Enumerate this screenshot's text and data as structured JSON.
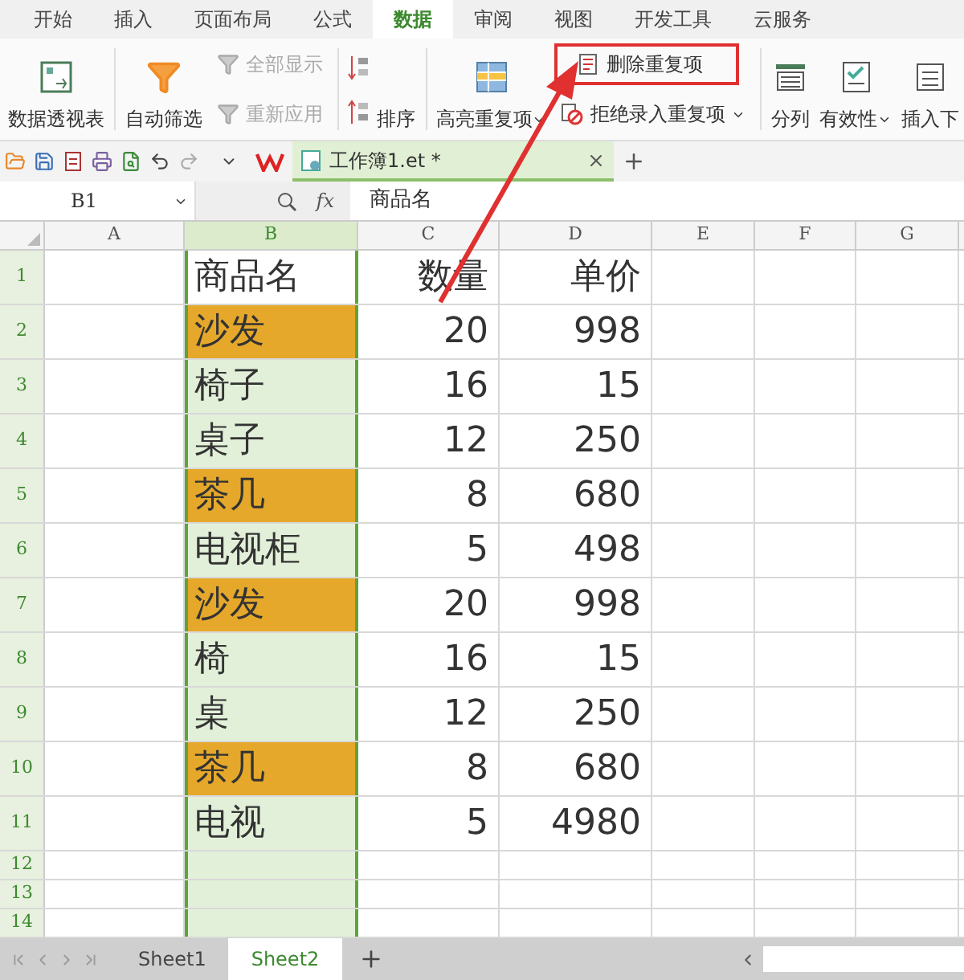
{
  "tabs": [
    {
      "label": "开始",
      "selected": false
    },
    {
      "label": "插入",
      "selected": false
    },
    {
      "label": "页面布局",
      "selected": false
    },
    {
      "label": "公式",
      "selected": false
    },
    {
      "label": "数据",
      "selected": true
    },
    {
      "label": "审阅",
      "selected": false
    },
    {
      "label": "视图",
      "selected": false
    },
    {
      "label": "开发工具",
      "selected": false
    },
    {
      "label": "云服务",
      "selected": false
    }
  ],
  "ribbon": [
    {
      "kind": "large",
      "label": "数据透视表",
      "dropdown": false
    },
    {
      "kind": "sep"
    },
    {
      "kind": "large",
      "label": "自动筛选",
      "dropdown": false
    },
    {
      "kind": "stack",
      "items": [
        {
          "label": "全部显示",
          "disabled": true,
          "dropdown": false,
          "highlighted": false
        },
        {
          "label": "重新应用",
          "disabled": true,
          "dropdown": false,
          "highlighted": false
        }
      ]
    },
    {
      "kind": "sep"
    },
    {
      "kind": "sortpair"
    },
    {
      "kind": "large",
      "label": "排序",
      "dropdown": false
    },
    {
      "kind": "sep"
    },
    {
      "kind": "large",
      "label": "高亮重复项",
      "dropdown": true
    },
    {
      "kind": "stack",
      "items": [
        {
          "label": "删除重复项",
          "disabled": false,
          "dropdown": false,
          "highlighted": true
        },
        {
          "label": "拒绝录入重复项",
          "disabled": false,
          "dropdown": true,
          "highlighted": false
        }
      ]
    },
    {
      "kind": "sep"
    },
    {
      "kind": "large",
      "label": "分列",
      "dropdown": false
    },
    {
      "kind": "large",
      "label": "有效性",
      "dropdown": true
    },
    {
      "kind": "large",
      "label": "插入下",
      "dropdown": false
    }
  ],
  "document_tab": {
    "title": "工作簿1.et *"
  },
  "formula_bar": {
    "name_box": "B1",
    "fx": "fx",
    "value": "商品名"
  },
  "columns": [
    {
      "label": "A",
      "selected": false
    },
    {
      "label": "B",
      "selected": true
    },
    {
      "label": "C",
      "selected": false
    },
    {
      "label": "D",
      "selected": false
    },
    {
      "label": "E",
      "selected": false
    },
    {
      "label": "F",
      "selected": false
    },
    {
      "label": "G",
      "selected": false
    }
  ],
  "rows": [
    {
      "number": "1",
      "cells": [
        "",
        "商品名",
        "数量",
        "单价"
      ],
      "duplicate": false
    },
    {
      "number": "2",
      "cells": [
        "",
        "沙发",
        "20",
        "998"
      ],
      "duplicate": true
    },
    {
      "number": "3",
      "cells": [
        "",
        "椅子",
        "16",
        "15"
      ],
      "duplicate": false
    },
    {
      "number": "4",
      "cells": [
        "",
        "桌子",
        "12",
        "250"
      ],
      "duplicate": false
    },
    {
      "number": "5",
      "cells": [
        "",
        "茶几",
        "8",
        "680"
      ],
      "duplicate": true
    },
    {
      "number": "6",
      "cells": [
        "",
        "电视柜",
        "5",
        "498"
      ],
      "duplicate": false
    },
    {
      "number": "7",
      "cells": [
        "",
        "沙发",
        "20",
        "998"
      ],
      "duplicate": true
    },
    {
      "number": "8",
      "cells": [
        "",
        "椅",
        "16",
        "15"
      ],
      "duplicate": false
    },
    {
      "number": "9",
      "cells": [
        "",
        "桌",
        "12",
        "250"
      ],
      "duplicate": false
    },
    {
      "number": "10",
      "cells": [
        "",
        "茶几",
        "8",
        "680"
      ],
      "duplicate": true
    },
    {
      "number": "11",
      "cells": [
        "",
        "电视",
        "5",
        "4980"
      ],
      "duplicate": false
    },
    {
      "number": "12",
      "cells": [],
      "duplicate": false
    },
    {
      "number": "13",
      "cells": [],
      "duplicate": false
    },
    {
      "number": "14",
      "cells": [],
      "duplicate": false
    }
  ],
  "sheets": [
    {
      "label": "Sheet1",
      "selected": false
    },
    {
      "label": "Sheet2",
      "selected": true
    }
  ]
}
